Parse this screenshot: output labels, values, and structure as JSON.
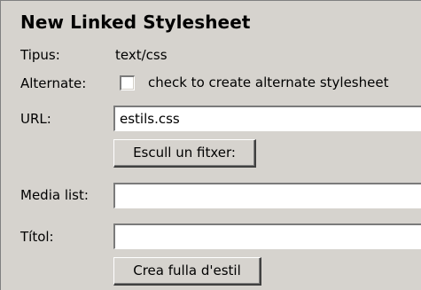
{
  "dialog": {
    "title": "New Linked Stylesheet",
    "type_label": "Tipus:",
    "type_value": "text/css",
    "alternate_label": "Alternate:",
    "alternate_checked": false,
    "alternate_checkbox_label": "check to create alternate stylesheet",
    "url_label": "URL:",
    "url_value": "estils.css",
    "choose_file_button": "Escull un fitxer:",
    "media_label": "Media list:",
    "media_value": "",
    "title_label": "Títol:",
    "title_value": "",
    "create_button": "Crea fulla d'estil"
  }
}
